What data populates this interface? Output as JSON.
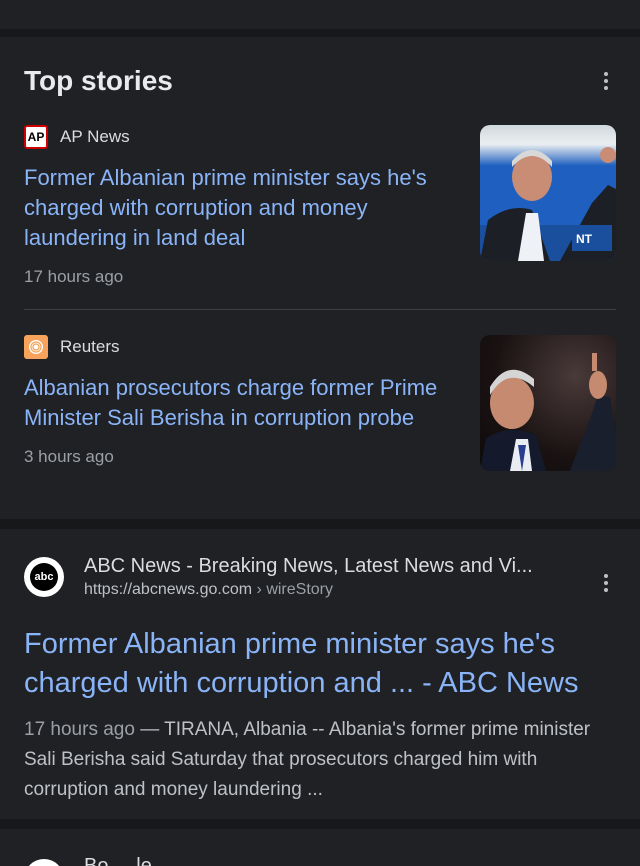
{
  "top_stories": {
    "title": "Top stories",
    "stories": [
      {
        "source": "AP News",
        "source_logo_text": "AP",
        "headline": "Former Albanian prime minister says he's charged with corruption and money laundering in land deal",
        "time": "17 hours ago"
      },
      {
        "source": "Reuters",
        "headline": "Albanian prosecutors charge former Prime Minister Sali Berisha in corruption probe",
        "time": "3 hours ago"
      }
    ]
  },
  "result": {
    "site_name": "ABC News - Breaking News, Latest News and Vi...",
    "logo_text": "abc",
    "url": "https://abcnews.go.com",
    "breadcrumb": "wireStory",
    "separator": " › ",
    "title": "Former Albanian prime minister says he's charged with corruption and ... - ABC News",
    "snippet_date": "17 hours ago",
    "snippet_text": " — TIRANA, Albania -- Albania's former prime minister Sali Berisha said Saturday that prosecutors charged him with corruption and money laundering ..."
  },
  "partial": {
    "text": "Bo ... le"
  },
  "colors": {
    "background": "#17181a",
    "card": "#202124",
    "link": "#8ab4f8",
    "text": "#e8eaed",
    "muted": "#9aa0a6"
  }
}
